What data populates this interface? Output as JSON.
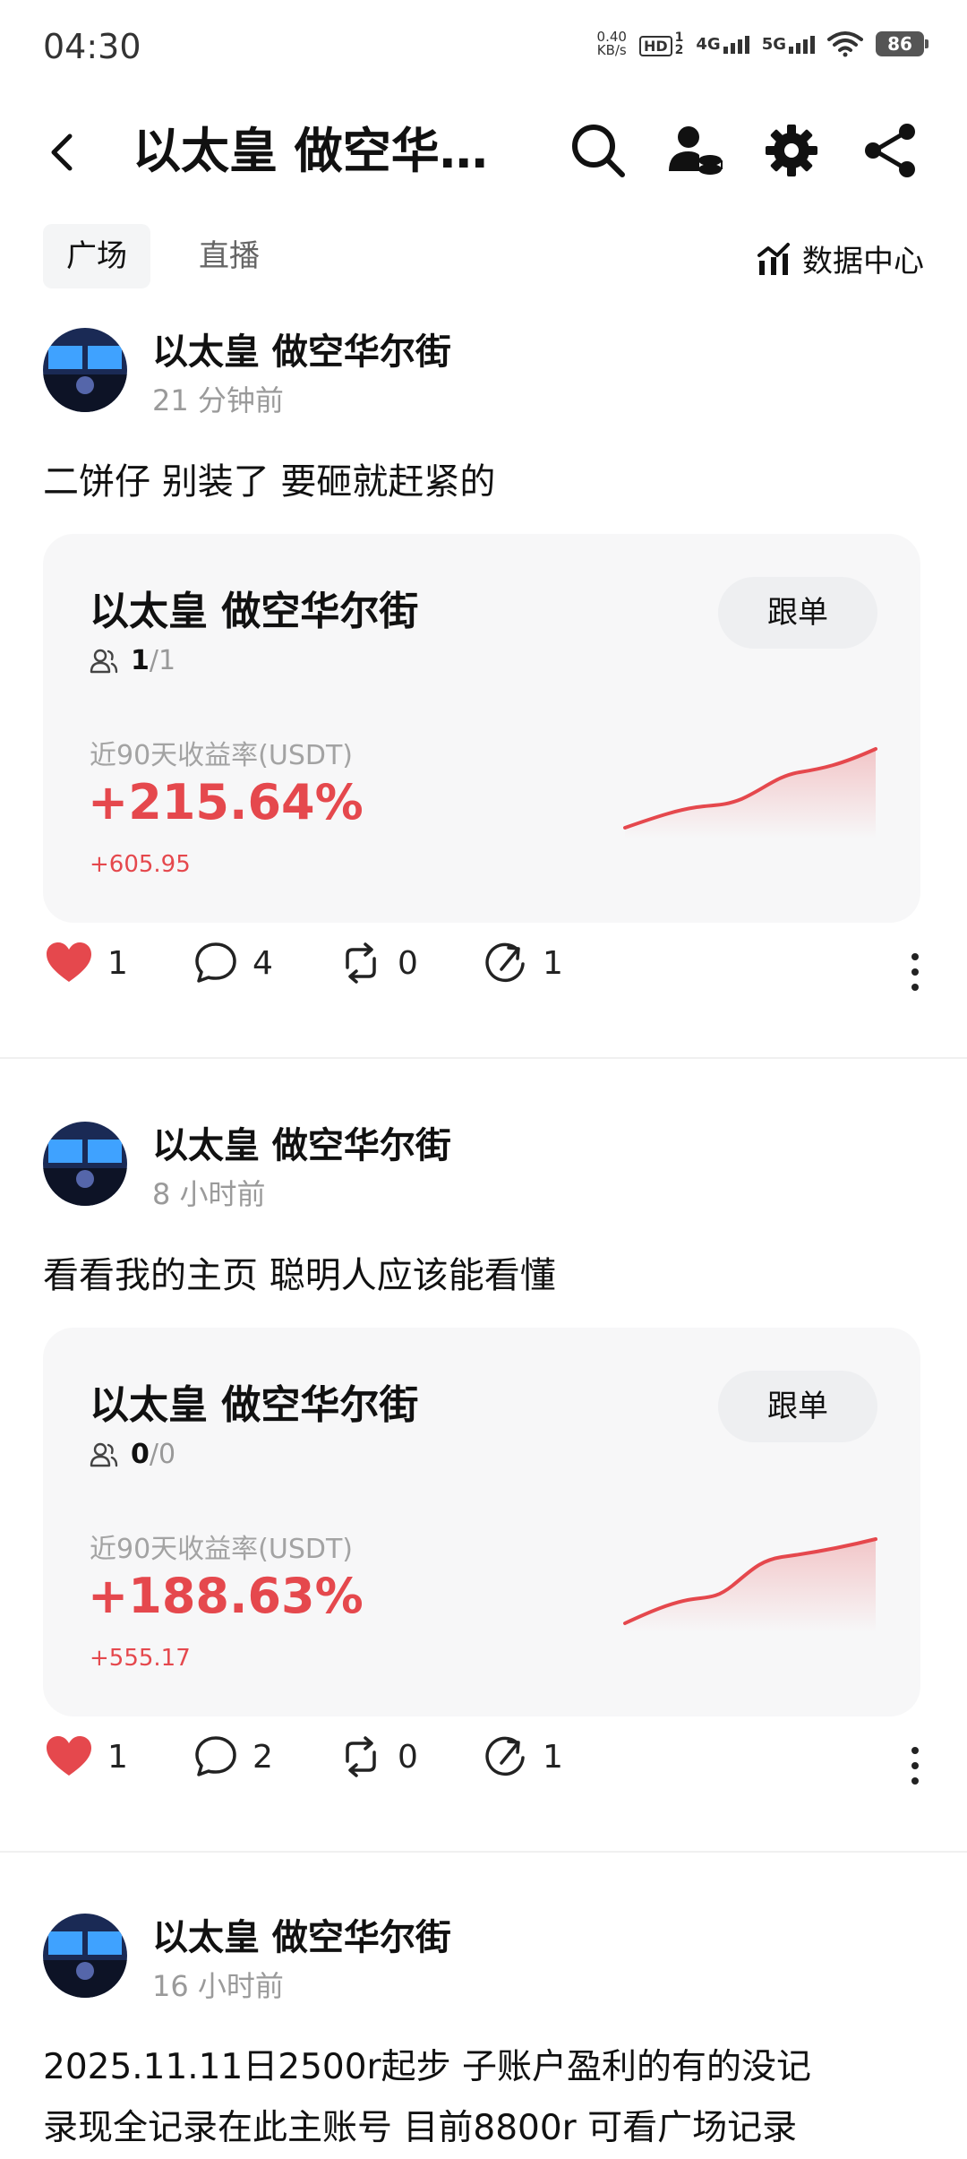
{
  "status_bar": {
    "time": "04:30",
    "net_speed_value": "0.40",
    "net_speed_unit": "KB/s",
    "hd_label": "HD",
    "sim1": "1",
    "sim2": "2",
    "net1": "4G",
    "net2": "5G",
    "battery": "86"
  },
  "nav": {
    "title": "以太皇 做空华…"
  },
  "tabs": [
    {
      "label": "广场",
      "active": true
    },
    {
      "label": "直播",
      "active": false
    }
  ],
  "data_center": "数据中心",
  "posts": [
    {
      "author": "以太皇 做空华尔街",
      "time": "21 分钟前",
      "text": "二饼仔 别装了 要砸就赶紧的",
      "card": {
        "name": "以太皇 做空华尔街",
        "follow": "跟单",
        "members_current": "1",
        "members_total": "/1",
        "yield_label": "近90天收益率(USDT)",
        "yield": "+215.64%",
        "profit": "+605.95"
      },
      "likes": "1",
      "comments": "4",
      "reposts": "0",
      "shares": "1"
    },
    {
      "author": "以太皇 做空华尔街",
      "time": "8 小时前",
      "text": "看看我的主页 聪明人应该能看懂",
      "card": {
        "name": "以太皇 做空华尔街",
        "follow": "跟单",
        "members_current": "0",
        "members_total": "/0",
        "yield_label": "近90天收益率(USDT)",
        "yield": "+188.63%",
        "profit": "+555.17"
      },
      "likes": "1",
      "comments": "2",
      "reposts": "0",
      "shares": "1"
    },
    {
      "author": "以太皇 做空华尔街",
      "time": "16 小时前",
      "text_line1": "2025.11.11日2500r起步 子账户盈利的有的没记",
      "text_line2": "录现全记录在此主账号 目前8800r 可看广场记录"
    }
  ],
  "colors": {
    "accent_red": "#e5484d",
    "card_bg": "#f7f7f8"
  }
}
